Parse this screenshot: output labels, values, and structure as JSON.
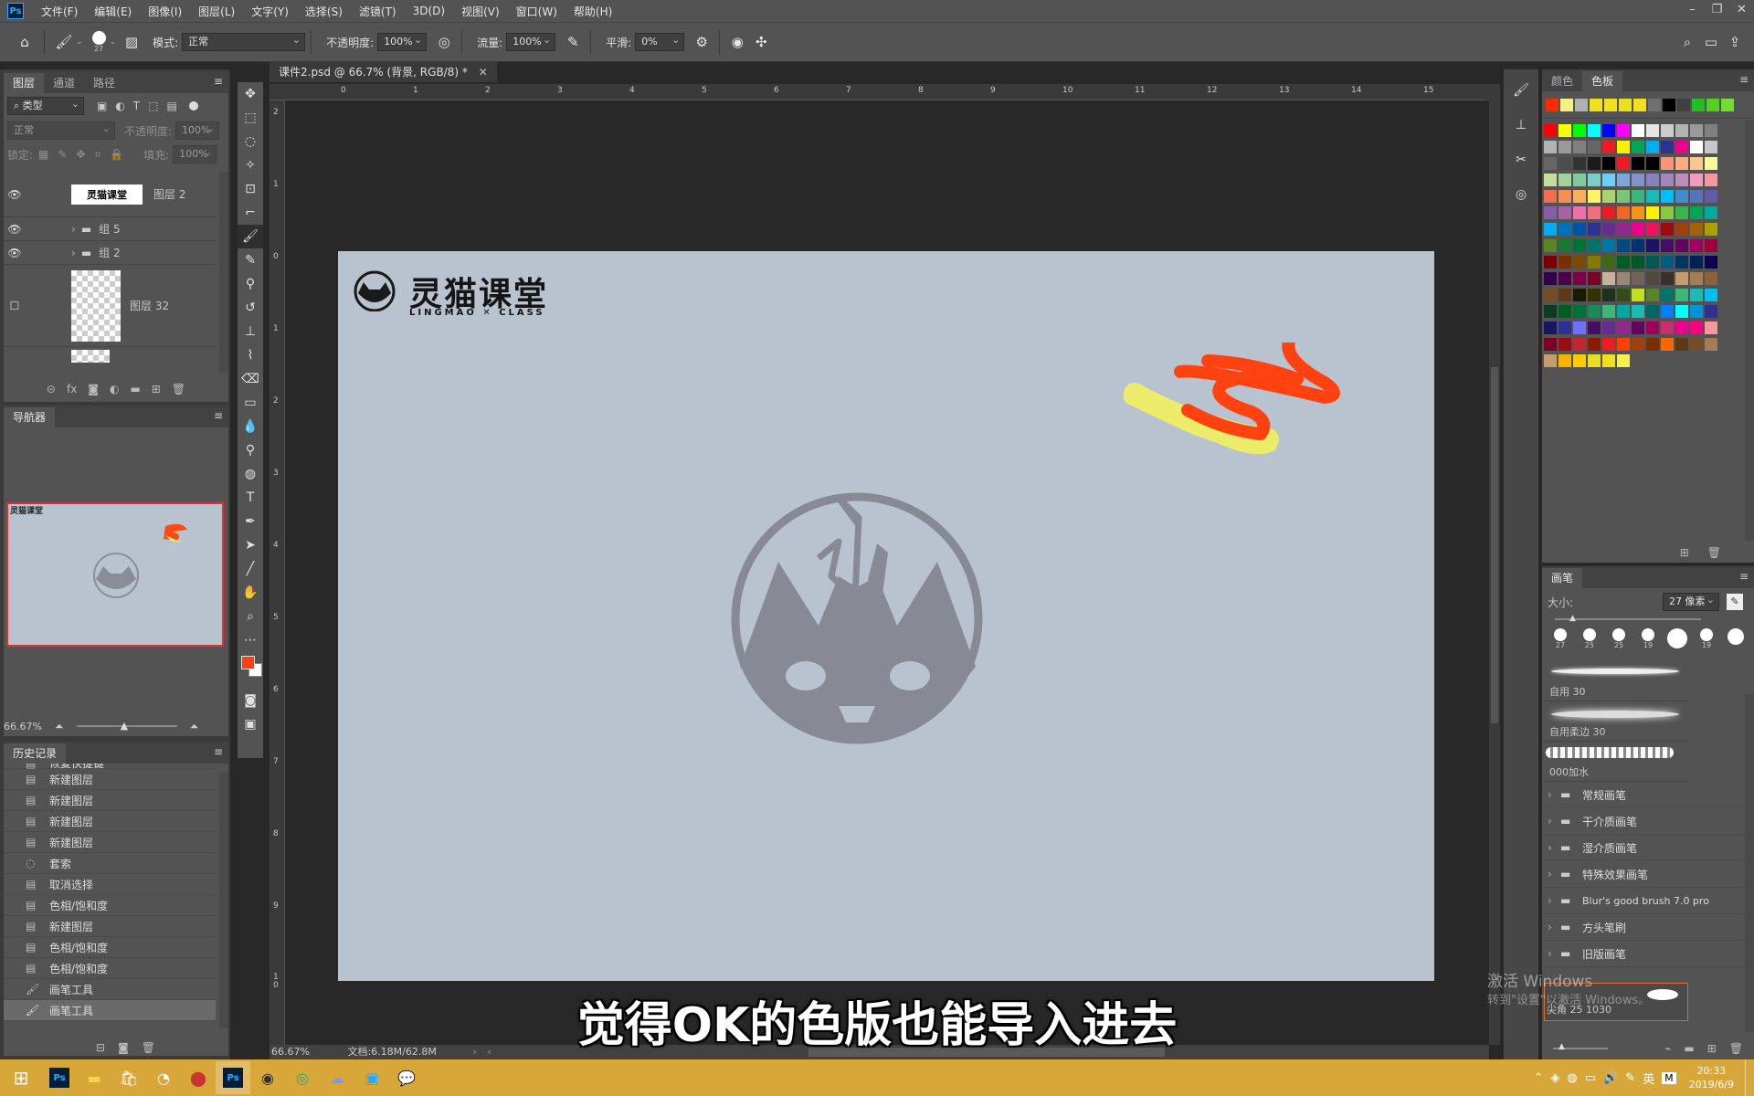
{
  "app": {
    "logo": "Ps"
  },
  "menu": [
    "文件(F)",
    "编辑(E)",
    "图像(I)",
    "图层(L)",
    "文字(Y)",
    "选择(S)",
    "滤镜(T)",
    "3D(D)",
    "视图(V)",
    "窗口(W)",
    "帮助(H)"
  ],
  "options": {
    "brush_size": "27",
    "mode_label": "模式:",
    "mode_value": "正常",
    "opacity_label": "不透明度:",
    "opacity_value": "100%",
    "flow_label": "流量:",
    "flow_value": "100%",
    "smooth_label": "平滑:",
    "smooth_value": "0%"
  },
  "layers_panel": {
    "tabs": [
      "图层",
      "通道",
      "路径"
    ],
    "filter": "类型",
    "blend": "正常",
    "opacity_label": "不透明度:",
    "opacity_value": "100%",
    "lock_label": "锁定:",
    "fill_label": "填充:",
    "fill_value": "100%",
    "layers": [
      {
        "name": "图层 2"
      },
      {
        "name": "组 5"
      },
      {
        "name": "组 2"
      },
      {
        "name": "图层 32"
      }
    ]
  },
  "navigator": {
    "title": "导航器",
    "zoom": "66.67%",
    "thumb_text": "灵猫课堂"
  },
  "history": {
    "title": "历史记录",
    "items": [
      "恢复快捷键",
      "新建图层",
      "新建图层",
      "新建图层",
      "新建图层",
      "套索",
      "取消选择",
      "色相/饱和度",
      "新建图层",
      "色相/饱和度",
      "色相/饱和度",
      "画笔工具",
      "画笔工具"
    ]
  },
  "document": {
    "tab_title": "课件2.psd @ 66.7% (背景, RGB/8) *",
    "logo_cn": "灵猫课堂",
    "logo_en": "LINGMAO ✕ CLASS",
    "ruler_numbers": [
      "0",
      "1",
      "2",
      "3",
      "4",
      "5",
      "6",
      "7",
      "8",
      "9",
      "10",
      "11",
      "12",
      "13",
      "14",
      "15"
    ],
    "ruler_v_numbers": [
      "2",
      "1",
      "0",
      "1",
      "2",
      "3",
      "4",
      "5",
      "6",
      "7",
      "8",
      "9",
      "1 0"
    ],
    "canvas_color": "#b9c3d0",
    "status_zoom": "66.67%",
    "status_doc": "文档:6.18M/62.8M"
  },
  "subtitle": "觉得OK的色版也能导入进去",
  "swatches_panel": {
    "tabs": [
      "颜色",
      "色板"
    ],
    "recent": [
      "#ff2a00",
      "#f5f080",
      "#b0b0b0",
      "#f0e020",
      "#f0e020",
      "#e8e020",
      "#f0e020",
      "#707070",
      "#000000",
      "#404040",
      "#20c020",
      "#50d020",
      "#70e030"
    ],
    "grid": [
      [
        "#ff0000",
        "#ffff00",
        "#00ff00",
        "#00ffff",
        "#0000ff",
        "#ff00ff",
        "#ffffff",
        "#e6e6e6",
        "#cccccc",
        "#b3b3b3",
        "#999999",
        "#808080"
      ],
      [
        "#b3b3b3",
        "#999999",
        "#808080",
        "#666666",
        "#ed1c24",
        "#fff200",
        "#00a651",
        "#00aeef",
        "#2e3192",
        "#ec008c",
        "#ffffff",
        "#c7c7c7"
      ],
      [
        "#666666",
        "#4d4d4d",
        "#333333",
        "#1a1a1a",
        "#000000",
        "#ed1c24",
        "#000000",
        "#000000",
        "#f7977a",
        "#f9ad81",
        "#fdc68a",
        "#fff79a"
      ],
      [
        "#c4df9b",
        "#a3d39c",
        "#82ca9d",
        "#7bcdc8",
        "#6ecff6",
        "#7ea7d8",
        "#8393ca",
        "#8781bd",
        "#a187be",
        "#bc8dbf",
        "#f49ac1",
        "#f6989d"
      ],
      [
        "#f26c4f",
        "#f68e55",
        "#fbaf5c",
        "#fff467",
        "#acd372",
        "#7cc576",
        "#3bb878",
        "#1abbb4",
        "#00bff3",
        "#438ccb",
        "#5574b9",
        "#605ca8"
      ],
      [
        "#855fa8",
        "#a763a8",
        "#f06ea9",
        "#f26d7d",
        "#ed1c24",
        "#f26522",
        "#f7941d",
        "#fff200",
        "#8dc63f",
        "#39b54a",
        "#00a651",
        "#00a99d"
      ],
      [
        "#00aeef",
        "#0072bc",
        "#0054a6",
        "#2e3192",
        "#662d91",
        "#92278f",
        "#ec008c",
        "#ed145b",
        "#9e0b0f",
        "#a0410d",
        "#a36209",
        "#aba000"
      ],
      [
        "#598527",
        "#1a7b30",
        "#007236",
        "#00746b",
        "#0076a3",
        "#004a80",
        "#003471",
        "#1b1464",
        "#440e62",
        "#630460",
        "#9e005d",
        "#9e0039"
      ],
      [
        "#790000",
        "#7b2e00",
        "#7d4900",
        "#827b00",
        "#406618",
        "#005e20",
        "#005826",
        "#005952",
        "#005b7f",
        "#003663",
        "#002157",
        "#0d004c"
      ],
      [
        "#32004b",
        "#4b0049",
        "#7b0046",
        "#7a0026",
        "#c7b299",
        "#998675",
        "#736357",
        "#534741",
        "#37302d",
        "#c69c6d",
        "#a67c52",
        "#8c6239"
      ],
      [
        "#754c24",
        "#603913",
        "#1a1a00",
        "#333300",
        "#1a331a",
        "#334d1a",
        "#c2e01e",
        "#598527",
        "#00746b",
        "#3bb878",
        "#1abbb4",
        "#00bff3"
      ],
      [
        "#0d3d1f",
        "#005e20",
        "#007236",
        "#198a5a",
        "#3bb878",
        "#00a99d",
        "#1abbb4",
        "#006666",
        "#007fff",
        "#00ffff",
        "#0095db",
        "#2e3192"
      ],
      [
        "#1b1464",
        "#2e3192",
        "#7070ff",
        "#440e62",
        "#662d91",
        "#92278f",
        "#630460",
        "#9e005d",
        "#c8306c",
        "#ec008c",
        "#ff0080",
        "#f6989d"
      ],
      [
        "#7a0026",
        "#9e0b0f",
        "#c1272d",
        "#8c1a00",
        "#ed1c24",
        "#ff4000",
        "#a0410d",
        "#7b2e00",
        "#ff6600",
        "#603913",
        "#754c24",
        "#a67c52"
      ],
      [
        "#c69c6d",
        "#f7b500",
        "#ffcc00",
        "#e8e020",
        "#f0e020",
        "#f5f050"
      ]
    ]
  },
  "brush_panel": {
    "title": "画笔",
    "size_label": "大小:",
    "size_value": "27 像素",
    "presets": [
      "27",
      "25",
      "25",
      "19",
      "",
      "19",
      ""
    ],
    "strokes": [
      {
        "name": "自用 30"
      },
      {
        "name": "自用柔边 30"
      },
      {
        "name": "000加水"
      }
    ],
    "folders": [
      "常规画笔",
      "干介质画笔",
      "湿介质画笔",
      "特殊效果画笔",
      "Blur's good brush 7.0 pro",
      "方头笔刷",
      "旧版画笔"
    ],
    "current": "尖角 25 1030",
    "watermark1": "激活 Windows",
    "watermark2": "转到\"设置\"以激活 Windows。"
  },
  "taskbar": {
    "time": "20:33",
    "date": "2019/6/9",
    "ime": "英",
    "color": "#d7a73a"
  }
}
